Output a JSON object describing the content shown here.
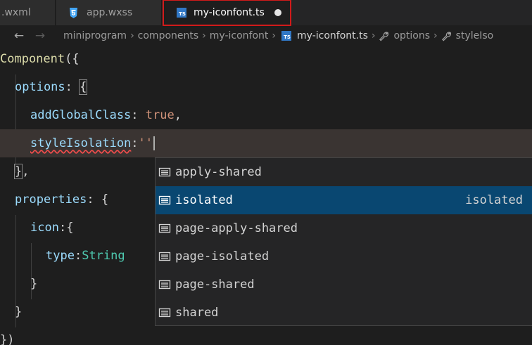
{
  "tabs": [
    {
      "label": ".wxml",
      "type": "wxml",
      "active": false
    },
    {
      "label": "app.wxss",
      "type": "css",
      "active": false
    },
    {
      "label": "my-iconfont.ts",
      "type": "ts",
      "active": true,
      "dirty": true
    }
  ],
  "icons": {
    "css_file": "css3-shield-icon",
    "ts_file": "typescript-icon",
    "wrench": "wrench-icon",
    "suggestion": "property-icon"
  },
  "colors": {
    "accent_selected": "#094771",
    "ts_badge": "#3178c6",
    "css_icon": "#42a5f5",
    "highlight_box": "#d11a1a",
    "error_squiggle": "#f14c4c"
  },
  "breadcrumb": {
    "back": "←",
    "forward": "→",
    "items": [
      "miniprogram",
      "components",
      "my-iconfont"
    ],
    "file": "my-iconfont.ts",
    "symbols": [
      "options",
      "styleIso"
    ],
    "separator": "›"
  },
  "code": {
    "l1": {
      "fn": "Component",
      "rest": "({"
    },
    "l2": {
      "key": "options",
      "colon": ": ",
      "brace": "{"
    },
    "l3": {
      "key": "addGlobalClass",
      "colon": ": ",
      "value": "true",
      "comma": ","
    },
    "l4": {
      "key": "styleIsolation",
      "colon": ":",
      "str": "''"
    },
    "l5": {
      "close": "}",
      "comma": ","
    },
    "l6": {
      "key": "properties",
      "colon": ": ",
      "brace": "{"
    },
    "l7": {
      "key": "icon",
      "colon": ":",
      "brace": "{"
    },
    "l8": {
      "key": "type",
      "colon": ":",
      "value": "String"
    },
    "l9": {
      "close": "}"
    },
    "l10": {
      "close": "}"
    },
    "l11": {
      "close": "})"
    }
  },
  "suggestions": {
    "items": [
      {
        "label": "apply-shared",
        "detail": ""
      },
      {
        "label": "isolated",
        "detail": "isolated",
        "selected": true
      },
      {
        "label": "page-apply-shared",
        "detail": ""
      },
      {
        "label": "page-isolated",
        "detail": ""
      },
      {
        "label": "page-shared",
        "detail": ""
      },
      {
        "label": "shared",
        "detail": ""
      }
    ]
  }
}
